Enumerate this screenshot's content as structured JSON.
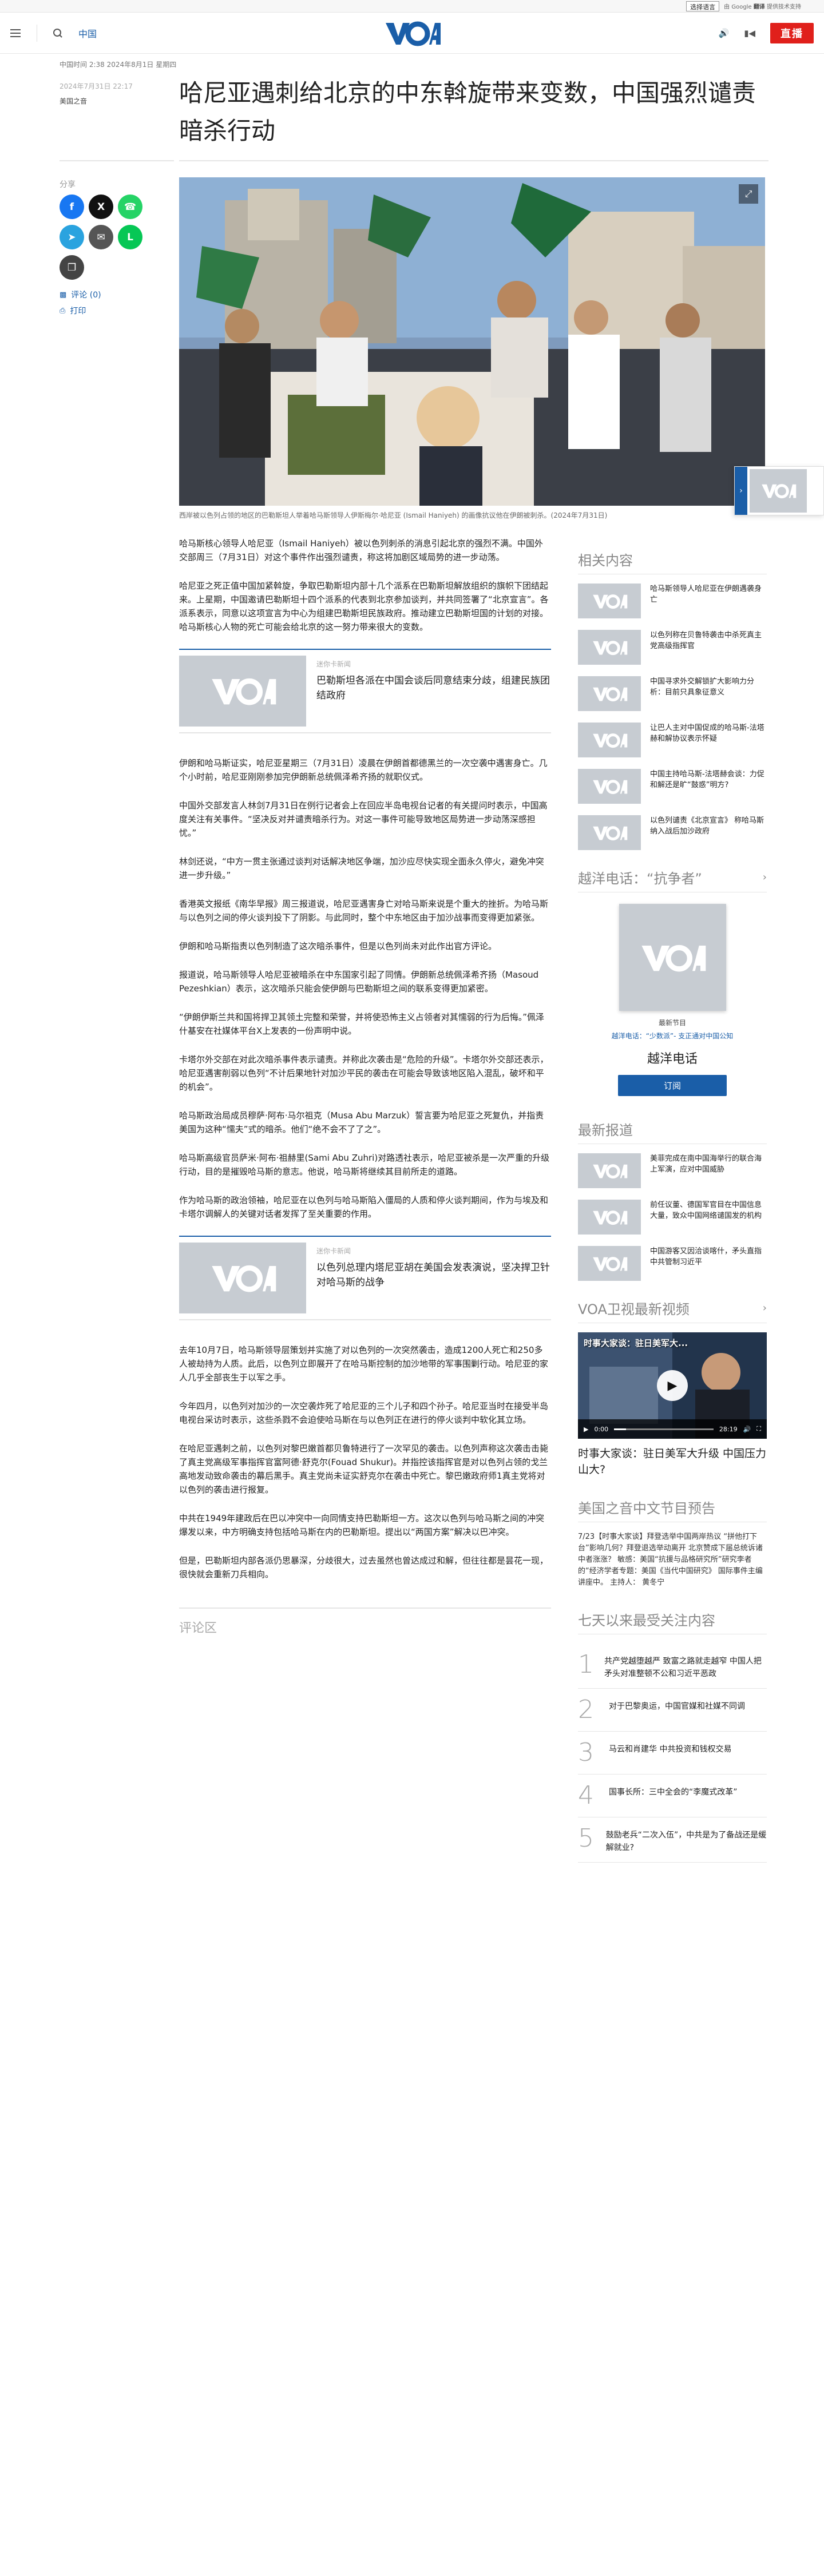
{
  "translate": {
    "select_label": "选择语言",
    "powered_by": "由 Google",
    "powered_brand": "翻译",
    "powered_suffix": "提供技术支持"
  },
  "header": {
    "section": "中国",
    "logo": "VOA",
    "live_label": "直播"
  },
  "meta": {
    "timestamp_line": "中国时间 2:38 2024年8月1日 星期四",
    "date": "2024年7月31日 22:17",
    "author": "美国之音"
  },
  "article": {
    "title": "哈尼亚遇刺给北京的中东斡旋带来变数，中国强烈谴责暗杀行动",
    "caption": "西岸被以色列占领的地区的巴勒斯坦人举着哈马斯领导人伊斯梅尔·哈尼亚 (Ismail Haniyeh) 的画像抗议他在伊朗被刺杀。(2024年7月31日)",
    "paragraphs_a": [
      "哈马斯核心领导人哈尼亚（Ismail Haniyeh）被以色列刺杀的消息引起北京的强烈不满。中国外交部周三（7月31日）对这个事件作出强烈谴责，称这将加剧区域局势的进一步动荡。",
      "哈尼亚之死正值中国加紧斡旋，争取巴勒斯坦内部十几个派系在巴勒斯坦解放组织的旗帜下团结起来。上星期，中国邀请巴勒斯坦十四个派系的代表到北京参加谈判，并共同签署了“北京宣言”。各派系表示，同意以这项宣言为中心为组建巴勒斯坦民族政府。推动建立巴勒斯坦国的计划的对接。哈马斯核心人物的死亡可能会给北京的这一努力带来很大的变数。"
    ],
    "related1": {
      "kicker": "迷你卡新闻",
      "title": "巴勒斯坦各派在中国会谈后同意结束分歧，组建民族团结政府"
    },
    "paragraphs_b": [
      "伊朗和哈马斯证实，哈尼亚星期三（7月31日）凌晨在伊朗首都德黑兰的一次空袭中遇害身亡。几个小时前，哈尼亚刚刚参加完伊朗新总统佩泽希齐扬的就职仪式。",
      "中国外交部发言人林剑7月31日在例行记者会上在回应半岛电视台记者的有关提问时表示，中国高度关注有关事件。“坚决反对并谴责暗杀行为。对这一事件可能导致地区局势进一步动荡深感担忧。”",
      "林剑还说，“中方一贯主张通过谈判对话解决地区争端，加沙应尽快实现全面永久停火，避免冲突进一步升级。”",
      "香港英文报纸《南华早报》周三报道说，哈尼亚遇害身亡对哈马斯来说是个重大的挫折。为哈马斯与以色列之间的停火谈判投下了阴影。与此同时，整个中东地区由于加沙战事而变得更加紧张。",
      "伊朗和哈马斯指责以色列制造了这次暗杀事件，但是以色列尚未对此作出官方评论。",
      "报道说，哈马斯领导人哈尼亚被暗杀在中东国家引起了同情。伊朗新总统佩泽希齐扬（Masoud Pezeshkian）表示，这次暗杀只能会使伊朗与巴勒斯坦之间的联系变得更加紧密。",
      "“伊朗伊斯兰共和国将捍卫其领土完整和荣誉，并将使恐怖主义占领者对其懦弱的行为后悔。”佩泽什基安在社媒体平台X上发表的一份声明中说。",
      "卡塔尔外交部在对此次暗杀事件表示谴责。并称此次袭击是“危险的升级”。卡塔尔外交部还表示，哈尼亚遇害削弱以色列“不计后果地针对加沙平民的袭击在可能会导致该地区陷入混乱，破坏和平的机会”。",
      "哈马斯政治局成员穆萨·阿布·马尔祖克（Musa Abu Marzuk）誓言要为哈尼亚之死复仇，并指责美国为这种“懦夫”式的暗杀。他们“绝不会不了了之”。",
      "哈马斯高级官员萨米·阿布·祖赫里(Sami Abu Zuhri)对路透社表示，哈尼亚被杀是一次严重的升级行动，目的是摧毁哈马斯的意志。他说，哈马斯将继续其目前所走的道路。",
      "作为哈马斯的政治领袖，哈尼亚在以色列与哈马斯陷入僵局的人质和停火谈判期间，作为与埃及和卡塔尔调解人的关键对话者发挥了至关重要的作用。"
    ],
    "related2": {
      "kicker": "迷你卡新闻",
      "title": "以色列总理内塔尼亚胡在美国会发表演说，坚决捍卫针对哈马斯的战争"
    },
    "paragraphs_c": [
      "去年10月7日，哈马斯领导层策划并实施了对以色列的一次突然袭击，造成1200人死亡和250多人被劫持为人质。此后，以色列立即展开了在哈马斯控制的加沙地带的军事围剿行动。哈尼亚的家人几乎全部丧生于以军之手。",
      "今年四月，以色列对加沙的一次空袭炸死了哈尼亚的三个儿子和四个孙子。哈尼亚当时在接受半岛电视台采访时表示，这些杀戮不会迫使哈马斯在与以色列正在进行的停火谈判中软化其立场。",
      "在哈尼亚遇刺之前，以色列对黎巴嫩首都贝鲁特进行了一次罕见的袭击。以色列声称这次袭击击毙了真主党高级军事指挥官富阿德·舒克尔(Fouad Shukur)。并指控该指挥官是对以色列占领的戈兰高地发动致命袭击的幕后黑手。真主党尚未证实舒克尔在袭击中死亡。黎巴嫩政府师1真主党将对以色列的袭击进行报复。",
      "中共在1949年建政后在巴以冲突中一向同情支持巴勒斯坦一方。这次以色列与哈马斯之间的冲突爆发以来，中方明确支持包括哈马斯在内的巴勒斯坦。提出以“两国方案”解决以巴冲突。",
      "但是，巴勒斯坦内部各派仍思暴深，分歧很大，过去虽然也曾达成过和解，但往往都是昙花一现，很快就会重新刀兵相向。"
    ],
    "comments_label": "评论区"
  },
  "share": {
    "label": "分享",
    "comments_link": "评论 (0)",
    "print_link": "打印"
  },
  "sidebar": {
    "related_heading": "相关内容",
    "related": [
      "哈马斯领导人哈尼亚在伊朗遇袭身亡",
      "以色列称在贝鲁特袭击中杀死真主党高级指挥官",
      "中国寻求外交解锁扩大影响力分析：目前只具象征意义",
      "让巴人主对中国促成的哈马斯-法塔赫和解协议表示怀疑",
      "中国主持哈马斯-法塔赫会谈：力促和解还是旷“鼓惑”明方?",
      "以色列谴责《北京宣言》 称哈马斯纳入战后加沙政府"
    ],
    "radio_heading": "越洋电话：“抗争者”",
    "radio_sub1": "最新节目",
    "radio_sub2": "越洋电话：“少数派”- 支正通对中国公知",
    "radio_name": "越洋电话",
    "subscribe_label": "订阅",
    "latest_heading": "最新报道",
    "latest": [
      "美菲完成在南中国海举行的联合海上军演，应对中国威胁",
      "前任议董、德国军官目在中国信息大量，致众中国网络谴国发的机构",
      "中国游客又因洽谈喀什，矛头直指中共管制习近平"
    ],
    "video_heading": "VOA卫视最新视频",
    "video_overlay": "时事大家谈：驻日美军大...",
    "video_time": "0:00",
    "video_duration": "28:19",
    "video_title": "时事大家谈：驻日美军大升级 中国压力山大?",
    "preview_heading": "美国之音中文节目预告",
    "preview_text": "7/23【时事大家谈】拜登选举中国两岸热议 “拼他打下台”影响几何？拜登退选举动离开 北京赞成下届总统诉诸中者涨涨？ 敏感：美国“抗援与品格研究所”研究李者的“经济学者专题：美国《当代中国研究》 国际事件主编讲座中。 主持人： 黄冬宁",
    "popular_heading": "七天以来最受关注内容",
    "popular": [
      "共产党越堕越严 致富之路就走越窄 中国人把矛头对准整顿不公和习近平恶政",
      "对于巴黎奥运，中国官媒和社媒不同调",
      "马云和肖建华 中共投资和钱权交易",
      "国事长所：三中全会的“李魔式改革”",
      "鼓励老兵“二次入伍”，中共是为了备战还是缓解就业?"
    ]
  }
}
